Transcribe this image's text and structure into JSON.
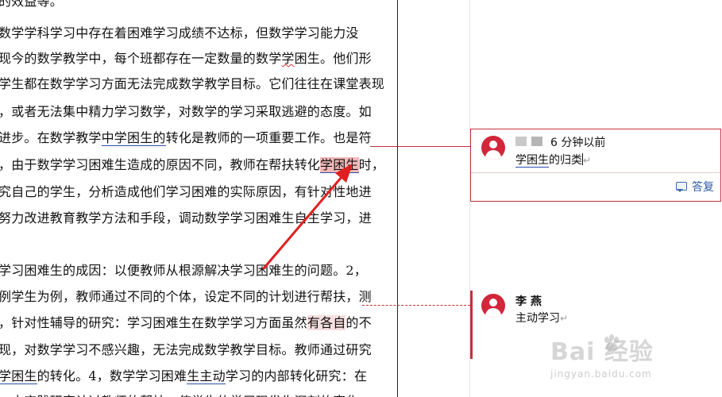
{
  "document": {
    "lines": [
      {
        "parts": [
          {
            "t": "的效益等。"
          }
        ]
      },
      {
        "parts": [
          {
            "t": "数学学科学习中存在着困难学习成绩不达标，但数学学习能力没"
          }
        ]
      },
      {
        "parts": [
          {
            "t": "现今的数学教学中，每个班都存在一定数量的数学"
          },
          {
            "t": "学",
            "style": "u-red-wave"
          },
          {
            "t": "困生。他们形"
          }
        ]
      },
      {
        "parts": [
          {
            "t": "学生都在数学学习方面无法完成数学教学目标。它们往往在课堂表现"
          }
        ]
      },
      {
        "parts": [
          {
            "t": "，或者无法集中精力学习数学，对数学的学习采取逃避的态度。如"
          }
        ]
      },
      {
        "parts": [
          {
            "t": "进步。在数学教学"
          },
          {
            "t": "中学困生的",
            "style": "u-blue"
          },
          {
            "t": "转化是教师的一项重要工作。也是符"
          }
        ]
      },
      {
        "parts": [
          {
            "t": "，由于数学学习困难生造成的原因不同，教师在帮扶转化"
          },
          {
            "t": "学困生",
            "style": "hl-red u-blue"
          },
          {
            "t": "时，"
          }
        ]
      },
      {
        "parts": [
          {
            "t": "究自己的学生，分析造成他们学习困难的实际原因，有针对性地进"
          }
        ]
      },
      {
        "parts": [
          {
            "t": "努力改进教育教学方法和手段，调动数学学习困难生自主学习，进"
          }
        ]
      },
      {
        "parts": [
          {
            "t": ""
          }
        ]
      },
      {
        "parts": [
          {
            "t": "学习困难生的成因：以便教师从根源解决学习困难生的问题。2，"
          }
        ]
      },
      {
        "parts": [
          {
            "t": "例学生为例，教师通过不同的个体，设定不同的计划进行帮扶，测"
          }
        ]
      },
      {
        "parts": [
          {
            "t": "，针对性辅导的研究：学习困难生在数学学习方面虽然"
          },
          {
            "t": "有各自",
            "style": "hl-pink"
          },
          {
            "t": "的不"
          }
        ]
      },
      {
        "parts": [
          {
            "t": "现，对数学学习不感兴趣，无法完成数学教学目标。教师通过研究"
          }
        ]
      },
      {
        "parts": [
          {
            "t": "学困生",
            "style": "u-blue"
          },
          {
            "t": "的转化。4，数学学习困难"
          },
          {
            "t": "生主动",
            "style": "u-blue"
          },
          {
            "t": "学习的内部转化研究：在"
          }
        ]
      },
      {
        "parts": [
          {
            "t": "，去实践研究认过教师的帮扶，使学生的学习现发生深刻的变化"
          }
        ]
      }
    ]
  },
  "comments": [
    {
      "author": "",
      "time": "6 分钟以前",
      "text_underlined": "学困生",
      "text_rest": "的归类",
      "para_mark": "↵",
      "reply_label": "答复"
    },
    {
      "author": "李 燕",
      "text": "主动学习",
      "para_mark": "↵"
    }
  ],
  "watermark": {
    "brand": "Bai  经验",
    "url": "jingyan.baidu.com"
  },
  "colors": {
    "comment_accent": "#c0333a",
    "avatar": "#d2263a",
    "link_blue": "#2a5aa8",
    "highlight": "#f2b8b8"
  }
}
